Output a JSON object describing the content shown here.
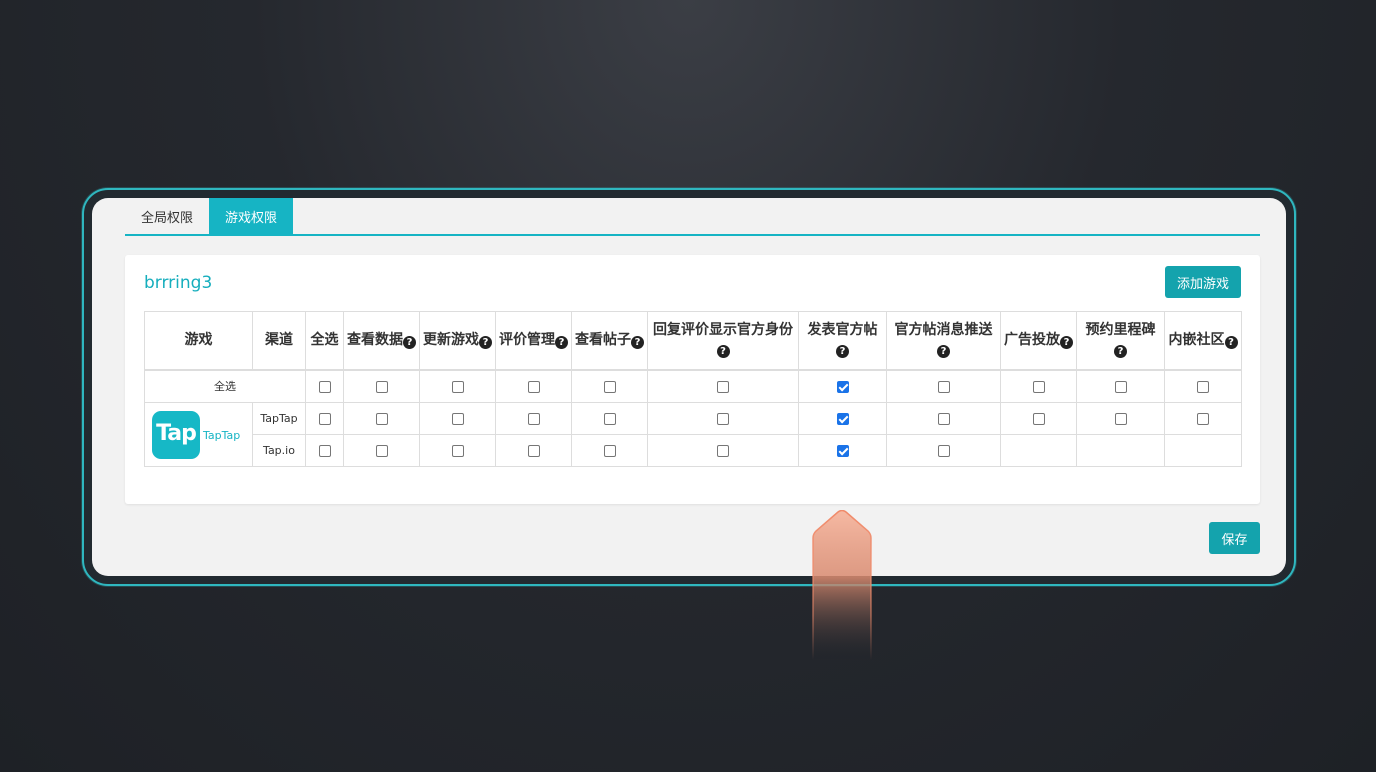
{
  "tabs": [
    {
      "label": "全局权限",
      "active": false
    },
    {
      "label": "游戏权限",
      "active": true
    }
  ],
  "game": {
    "title": "brrring3",
    "logo_text": "Tap",
    "logo_caption": "TapTap"
  },
  "buttons": {
    "add_game": "添加游戏",
    "save": "保存"
  },
  "table": {
    "headers": [
      "游戏",
      "渠道",
      "全选",
      "查看数据",
      "更新游戏",
      "评价管理",
      "查看帖子",
      "回复评价显示官方身份",
      "发表官方帖",
      "官方帖消息推送",
      "广告投放",
      "预约里程碑",
      "内嵌社区"
    ],
    "header_help": [
      false,
      false,
      false,
      true,
      true,
      true,
      true,
      true,
      true,
      true,
      true,
      true,
      true
    ],
    "select_all_label": "全选",
    "select_all_row": [
      false,
      false,
      false,
      false,
      false,
      false,
      true,
      false,
      false,
      false,
      false
    ],
    "rows": [
      {
        "channel": "TapTap",
        "checks": [
          false,
          false,
          false,
          false,
          false,
          false,
          true,
          false,
          false,
          false,
          false
        ]
      },
      {
        "channel": "Tap.io",
        "checks": [
          false,
          false,
          false,
          false,
          false,
          false,
          true,
          false,
          null,
          null,
          null
        ]
      }
    ]
  },
  "help_icon": "question-circle-icon",
  "colors": {
    "accent": "#16b4c4",
    "button": "#14a3ad",
    "checkbox_checked": "#1a73e8",
    "pointer": "#f08a6a"
  }
}
